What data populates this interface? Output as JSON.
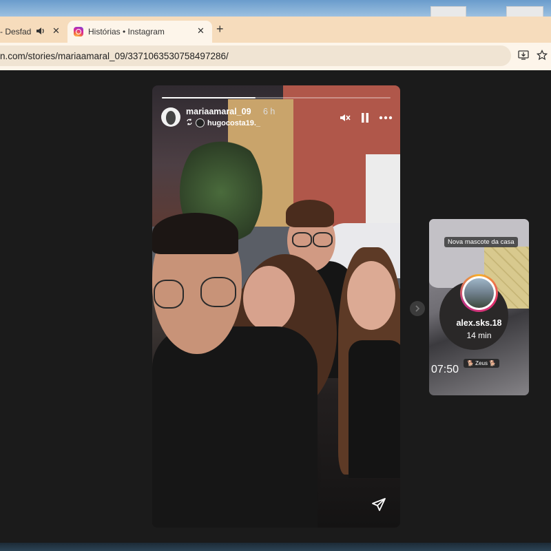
{
  "browser": {
    "tabs": [
      {
        "title": "- Desfad",
        "audio_icon": "speaker-icon",
        "active": false
      },
      {
        "title": "Histórias • Instagram",
        "active": true
      }
    ],
    "new_tab_label": "+",
    "close_label": "✕",
    "url": "n.com/stories/mariaamaral_09/3371063530758497286/"
  },
  "story": {
    "progress": 0.41,
    "username": "mariaamaral_09",
    "time_ago": "6 h",
    "reposted_from": "hugocosta19._"
  },
  "next_story": {
    "caption": "Nova mascote da casa",
    "username": "alex.sks.18",
    "time_ago": "14 min",
    "clock": "07:50",
    "tag": "🐕 Zeus 🐕"
  },
  "colors": {
    "tabbar": "#f6dcbc",
    "viewer_bg": "#1b1b1b"
  }
}
